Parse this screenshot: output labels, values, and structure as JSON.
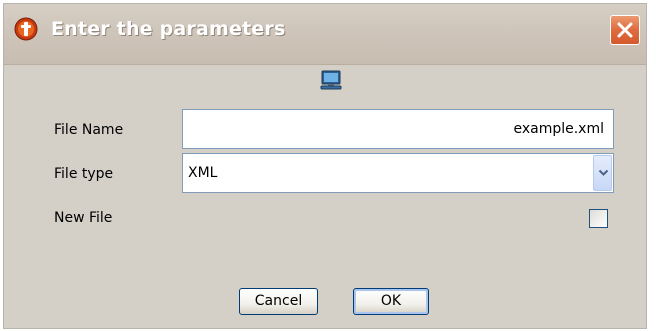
{
  "dialog": {
    "title": "Enter the parameters",
    "close_label": "×"
  },
  "form": {
    "file_name": {
      "label": "File Name",
      "value": "example.xml"
    },
    "file_type": {
      "label": "File type",
      "value": "XML"
    },
    "new_file": {
      "label": "New File",
      "checked": false
    }
  },
  "buttons": {
    "cancel": "Cancel",
    "ok": "OK"
  },
  "icons": {
    "title": "app-icon",
    "close": "close-icon",
    "computer": "computer-icon",
    "dropdown": "chevron-down-icon"
  },
  "colors": {
    "title_bar": "#ccc2b7",
    "close_button": "#e06b3f",
    "dialog_background": "#d4d0c8",
    "field_border": "#7f9db9"
  }
}
